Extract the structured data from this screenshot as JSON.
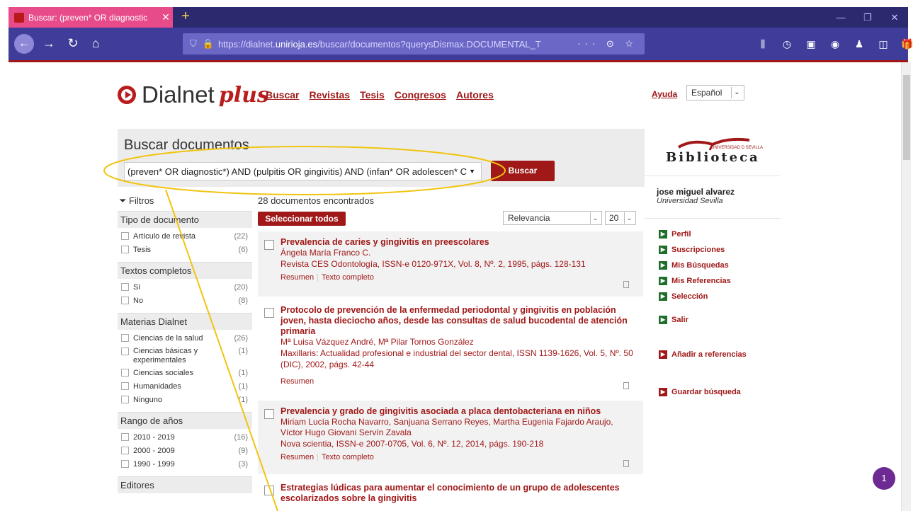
{
  "browser": {
    "tab_title": "Buscar: (preven* OR diagnostic",
    "url_prefix": "https://dialnet.",
    "url_host": "unirioja.es",
    "url_path": "/buscar/documentos?querysDismax.DOCUMENTAL_T",
    "url_actions": "··· ⊙ ☆"
  },
  "header": {
    "logo_text": "Dialnet",
    "logo_plus": "plus",
    "nav": [
      "Buscar",
      "Revistas",
      "Tesis",
      "Congresos",
      "Autores"
    ],
    "help": "Ayuda",
    "language": "Español"
  },
  "search": {
    "title": "Buscar documentos",
    "query": "(preven* OR diagnostic*) AND (pulpitis OR gingivitis) AND (infan* OR adolescen* C",
    "button": "Buscar"
  },
  "filters": {
    "title": "Filtros",
    "groups": [
      {
        "head": "Tipo de documento",
        "items": [
          {
            "label": "Artículo de revista",
            "count": "(22)"
          },
          {
            "label": "Tesis",
            "count": "(6)"
          }
        ]
      },
      {
        "head": "Textos completos",
        "items": [
          {
            "label": "Si",
            "count": "(20)"
          },
          {
            "label": "No",
            "count": "(8)"
          }
        ]
      },
      {
        "head": "Materias Dialnet",
        "items": [
          {
            "label": "Ciencias de la salud",
            "count": "(26)"
          },
          {
            "label": "Ciencias básicas y",
            "label2": "experimentales",
            "count": "(1)"
          },
          {
            "label": "Ciencias sociales",
            "count": "(1)"
          },
          {
            "label": "Humanidades",
            "count": "(1)"
          },
          {
            "label": "Ninguno",
            "count": "(1)"
          }
        ]
      },
      {
        "head": "Rango de años",
        "items": [
          {
            "label": "2010 - 2019",
            "count": "(16)"
          },
          {
            "label": "2000 - 2009",
            "count": "(9)"
          },
          {
            "label": "1990 - 1999",
            "count": "(3)"
          }
        ]
      },
      {
        "head": "Editores",
        "items": []
      }
    ]
  },
  "results": {
    "count_text": "28 documentos encontrados",
    "select_all": "Seleccionar todos",
    "sort": "Relevancia",
    "per_page": "20",
    "items": [
      {
        "title": "Prevalencia de caries y gingivitis en preescolares",
        "authors": "Ángela María Franco C.",
        "source": "Revista CES Odontología, ISSN-e 0120-971X, Vol. 8, Nº. 2, 1995, págs. 128-131",
        "links": [
          "Resumen",
          "Texto completo"
        ]
      },
      {
        "title": "Protocolo de prevención de la enfermedad periodontal y gingivitis en población joven, hasta dieciocho años, desde las consultas de salud bucodental de atención primaria",
        "authors": "Mª Luisa Vázquez André, Mª Pilar Tornos González",
        "source": "Maxillaris: Actualidad profesional e industrial del sector dental, ISSN 1139-1626, Vol. 5, Nº. 50 (DIC), 2002, págs. 42-44",
        "links": [
          "Resumen"
        ]
      },
      {
        "title": "Prevalencia y grado de gingivitis asociada a placa dentobacteriana en niños",
        "authors": "Miriam Lucía Rocha Navarro, Sanjuana Serrano Reyes, Martha Eugenia Fajardo Araujo, Víctor Hugo Giovani Servín Zavala",
        "source": "Nova scientia, ISSN-e 2007-0705, Vol. 6, Nº. 12, 2014, págs. 190-218",
        "links": [
          "Resumen",
          "Texto completo"
        ]
      },
      {
        "title": "Estrategias lúdicas para aumentar el conocimiento de un grupo de adolescentes escolarizados sobre la gingivitis",
        "authors": "",
        "source": "",
        "links": []
      }
    ]
  },
  "sidebar": {
    "library_word": "Biblioteca",
    "library_univ": "UNIVERSIDAD D SEVILLA",
    "user_name": "jose miguel alvarez",
    "user_univ": "Universidad Sevilla",
    "links": [
      "Perfil",
      "Suscripciones",
      "Mis Búsquedas",
      "Mis Referencias",
      "Selección",
      "Salir"
    ],
    "add_refs": "Añadir a referencias",
    "save_search": "Guardar búsqueda"
  },
  "notification_count": "1",
  "colors": {
    "brand": "#a01818",
    "annotation": "#f1c40f",
    "tab": "#e84b8a",
    "chrome": "#3f3c9a"
  }
}
